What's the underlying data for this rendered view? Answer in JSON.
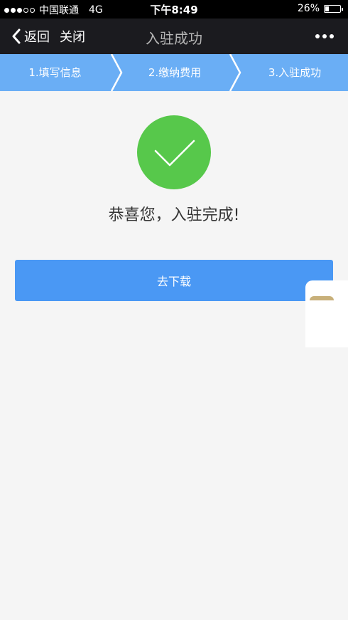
{
  "status_bar": {
    "carrier": "中国联通",
    "network": "4G",
    "time": "下午8:49",
    "battery_percent": "26%",
    "battery_level": 0.26,
    "signal_bars": 3,
    "signal_total": 5
  },
  "nav": {
    "back_label": "返回",
    "close_label": "关闭",
    "title": "入驻成功"
  },
  "steps": [
    {
      "label": "1.填写信息"
    },
    {
      "label": "2.缴纳费用"
    },
    {
      "label": "3.入驻成功"
    }
  ],
  "main": {
    "success_message": "恭喜您，入驻完成!",
    "download_label": "去下载"
  },
  "colors": {
    "step_bar": "#6aaef5",
    "check_green": "#57c84b",
    "button_blue": "#4a98f4"
  }
}
